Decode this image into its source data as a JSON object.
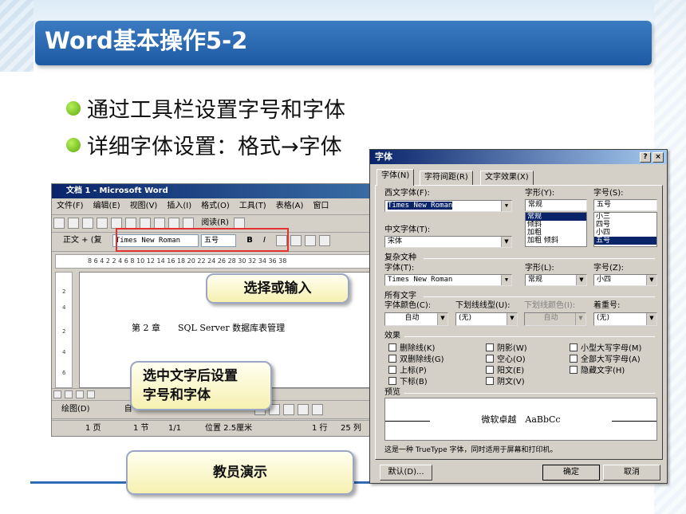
{
  "slide": {
    "title": "Word基本操作5-2",
    "bullets": [
      "通过工具栏设置字号和字体",
      "详细字体设置：格式→字体"
    ]
  },
  "word": {
    "title": "文档 1 - Microsoft Word",
    "menu": [
      "文件(F)",
      "编辑(E)",
      "视图(V)",
      "插入(I)",
      "格式(O)",
      "工具(T)",
      "表格(A)",
      "窗口"
    ],
    "read_label": "阅读(R)",
    "format_toolbar": {
      "style": "正文 + (复",
      "font": "Times New Roman",
      "size": "五号",
      "bold": "B",
      "italic": "I"
    },
    "ruler_numbers": "8 6 4 2 2 4 6 8 10 12 14 16 18 20 22 24 26 28 30 32 34 36 38",
    "vruler_numbers": [
      "2",
      "4",
      "2",
      "4",
      "6"
    ],
    "doc_text": "第 2 章　　SQL Server 数据库表管理",
    "draw_label": "绘图(D)",
    "autoshape_label": "自",
    "status": {
      "page": "1 页",
      "section": "1 节",
      "pages": "1/1",
      "position": "位置 2.5厘米",
      "line": "1 行",
      "col": "25 列"
    }
  },
  "callouts": {
    "select_input": "选择或输入",
    "set_font": "选中文字后设置\n字号和字体",
    "teacher_demo": "教员演示"
  },
  "dialog": {
    "title": "字体",
    "help_btn": "?",
    "close_btn": "×",
    "tabs": [
      "字体(N)",
      "字符间距(R)",
      "文字效果(X)"
    ],
    "western_font_label": "西文字体(F):",
    "western_font_value": "Times New Roman",
    "style_label": "字形(Y):",
    "style_value": "常规",
    "style_options": [
      "常规",
      "倾斜",
      "加粗",
      "加粗 倾斜"
    ],
    "size_label": "字号(S):",
    "size_value": "五号",
    "size_options": [
      "小三",
      "四号",
      "小四",
      "五号"
    ],
    "chinese_font_label": "中文字体(T):",
    "chinese_font_value": "宋体",
    "complex_group": "复杂文种",
    "complex_font_label": "字体(T):",
    "complex_font_value": "Times New Roman",
    "complex_style_label": "字形(L):",
    "complex_style_value": "常规",
    "complex_size_label": "字号(Z):",
    "complex_size_value": "小四",
    "all_text_group": "所有文字",
    "color_label": "字体颜色(C):",
    "color_value": "自动",
    "underline_label": "下划线线型(U):",
    "underline_value": "(无)",
    "underline_color_label": "下划线颜色(I):",
    "underline_color_value": "自动",
    "emphasis_label": "着重号:",
    "emphasis_value": "(无)",
    "effects_group": "效果",
    "effects": [
      [
        "删除线(K)",
        "阴影(W)",
        "小型大写字母(M)"
      ],
      [
        "双删除线(G)",
        "空心(O)",
        "全部大写字母(A)"
      ],
      [
        "上标(P)",
        "阳文(E)",
        "隐藏文字(H)"
      ],
      [
        "下标(B)",
        "阴文(V)",
        ""
      ]
    ],
    "preview_group": "预览",
    "preview_text": "微软卓越　AaBbCc",
    "note": "这是一种 TrueType 字体，同时适用于屏幕和打印机。",
    "default_btn": "默认(D)...",
    "ok_btn": "确定",
    "cancel_btn": "取消"
  }
}
